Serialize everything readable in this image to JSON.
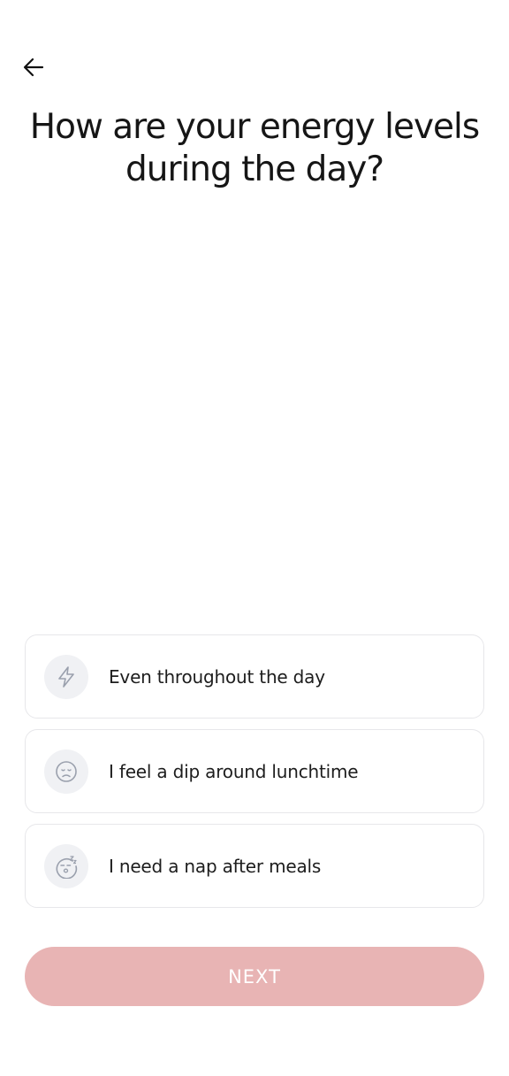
{
  "header": {
    "back_icon": "arrow-left-icon",
    "title": "How are your energy levels during the day?"
  },
  "options": [
    {
      "icon": "lightning-bolt-icon",
      "label": "Even throughout the day"
    },
    {
      "icon": "sad-face-icon",
      "label": "I feel a dip around lunchtime"
    },
    {
      "icon": "sleepy-face-icon",
      "label": "I need a nap after meals"
    }
  ],
  "footer": {
    "next_label": "NEXT"
  },
  "colors": {
    "next_button_bg": "#e8b4b4",
    "icon_stroke": "#9aa0ad",
    "icon_bg": "#f0f1f4",
    "option_border": "#e7e7ea"
  }
}
